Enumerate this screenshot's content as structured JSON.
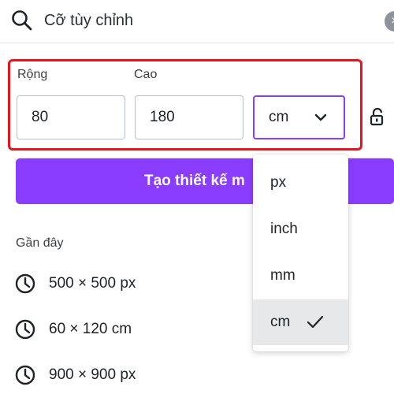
{
  "search": {
    "value": "Cỡ tùy chỉnh",
    "clear_label": "×"
  },
  "size": {
    "width_label": "Rộng",
    "height_label": "Cao",
    "width_value": "80",
    "height_value": "180",
    "unit": "cm"
  },
  "create_button": "Tạo thiết kế m",
  "recent": {
    "heading": "Gần đây",
    "items": [
      "500 × 500 px",
      "60 × 120 cm",
      "900 × 900 px"
    ]
  },
  "unit_options": [
    "px",
    "inch",
    "mm",
    "cm"
  ],
  "colors": {
    "accent": "#8b3dff",
    "highlight": "#e8141b",
    "selected_bg": "#e6e8ea"
  }
}
